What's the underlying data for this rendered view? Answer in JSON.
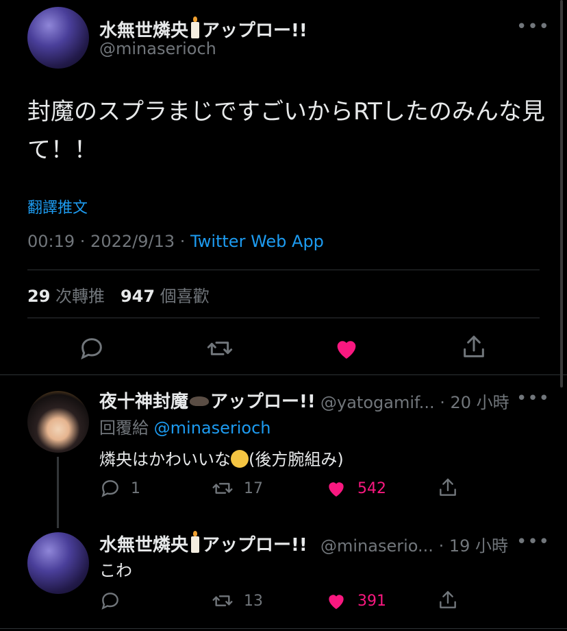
{
  "main_tweet": {
    "author_name": "水無世燐央",
    "author_suffix": "アップロー!!",
    "handle": "@minaserioch",
    "text": "封魔のスプラまじですごいからRTしたのみんな見て！！",
    "translate": "翻譯推文",
    "time": "00:19 · 2022/9/13 · ",
    "source": "Twitter Web App",
    "retweets_count": "29",
    "retweets_label": "次轉推",
    "likes_count": "947",
    "likes_label": "個喜歡"
  },
  "replies": [
    {
      "author_name": "夜十神封魔",
      "author_suffix": "アップロー!!",
      "handle": "@yatogamif...",
      "time": "· 20 小時",
      "reply_to_label": "回覆給",
      "reply_to_handle": "@minaserioch",
      "text": "燐央はかわいいな",
      "text_after": "(後方腕組み)",
      "reply_count": "1",
      "retweet_count": "17",
      "like_count": "542"
    },
    {
      "author_name": "水無世燐央",
      "author_suffix": "アップロー!!",
      "handle": "@minaserio...",
      "time": "· 19 小時",
      "text": "こわ",
      "retweet_count": "13",
      "like_count": "391"
    }
  ],
  "more_label": "•••",
  "colors": {
    "accent": "#1d9bf0",
    "like": "#f91880",
    "muted": "#71767b",
    "background": "#000000"
  },
  "icons": [
    "reply-icon",
    "retweet-icon",
    "like-icon",
    "share-icon",
    "more-icon"
  ]
}
